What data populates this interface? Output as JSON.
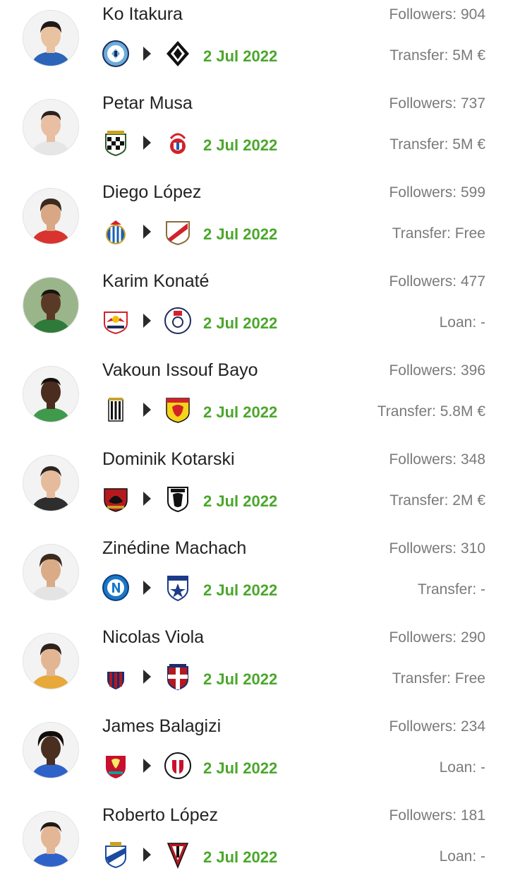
{
  "transfers": [
    {
      "name": "Ko Itakura",
      "followers": "Followers: 904",
      "date": "2 Jul 2022",
      "fee": "Transfer: 5M €",
      "from_club": "manchester-city-crest",
      "to_club": "gladbach-crest",
      "skin": "#e9c2a0",
      "hair": "#1f1a17",
      "shirt": "#2b64b8"
    },
    {
      "name": "Petar Musa",
      "followers": "Followers: 737",
      "date": "2 Jul 2022",
      "fee": "Transfer: 5M €",
      "from_club": "boavista-crest",
      "to_club": "benfica-crest",
      "skin": "#e8bfa2",
      "hair": "#2a211c",
      "shirt": "#e6e6e6"
    },
    {
      "name": "Diego López",
      "followers": "Followers: 599",
      "date": "2 Jul 2022",
      "fee": "Transfer: Free",
      "from_club": "espanyol-crest",
      "to_club": "rayo-vallecano-crest",
      "skin": "#d9a784",
      "hair": "#3a2a20",
      "shirt": "#d8332f"
    },
    {
      "name": "Karim Konaté",
      "followers": "Followers: 477",
      "date": "2 Jul 2022",
      "fee": "Loan: -",
      "from_club": "red-bull-salzburg-crest",
      "to_club": "fc-liefering-crest",
      "skin": "#5a3a26",
      "hair": "#1a1210",
      "shirt": "#2f7a3a"
    },
    {
      "name": "Vakoun Issouf Bayo",
      "followers": "Followers: 396",
      "date": "2 Jul 2022",
      "fee": "Transfer: 5.8M €",
      "from_club": "charleroi-crest",
      "to_club": "watford-crest",
      "skin": "#4a2d1e",
      "hair": "#15100d",
      "shirt": "#3f9a4c"
    },
    {
      "name": "Dominik Kotarski",
      "followers": "Followers: 348",
      "date": "2 Jul 2022",
      "fee": "Transfer: 2M €",
      "from_club": "gorica-crest",
      "to_club": "paok-crest",
      "skin": "#e6bb9c",
      "hair": "#2b2420",
      "shirt": "#2e2e2e"
    },
    {
      "name": "Zinédine Machach",
      "followers": "Followers: 310",
      "date": "2 Jul 2022",
      "fee": "Transfer: -",
      "from_club": "napoli-crest",
      "to_club": "pescara-crest",
      "skin": "#d9ab86",
      "hair": "#3b2a1e",
      "shirt": "#e4e4e4"
    },
    {
      "name": "Nicolas Viola",
      "followers": "Followers: 290",
      "date": "2 Jul 2022",
      "fee": "Transfer: Free",
      "from_club": "bologna-crest",
      "to_club": "cagliari-crest",
      "skin": "#e2b693",
      "hair": "#2e231c",
      "shirt": "#e7a93a"
    },
    {
      "name": "James Balagizi",
      "followers": "Followers: 234",
      "date": "2 Jul 2022",
      "fee": "Loan: -",
      "from_club": "liverpool-crest",
      "to_club": "crawley-town-crest",
      "skin": "#4a2e20",
      "hair": "#120d0b",
      "shirt": "#2f62c9"
    },
    {
      "name": "Roberto López",
      "followers": "Followers: 181",
      "date": "2 Jul 2022",
      "fee": "Loan: -",
      "from_club": "real-sociedad-crest",
      "to_club": "mirandes-crest",
      "skin": "#e3b796",
      "hair": "#1e1916",
      "shirt": "#2f62c9"
    }
  ]
}
